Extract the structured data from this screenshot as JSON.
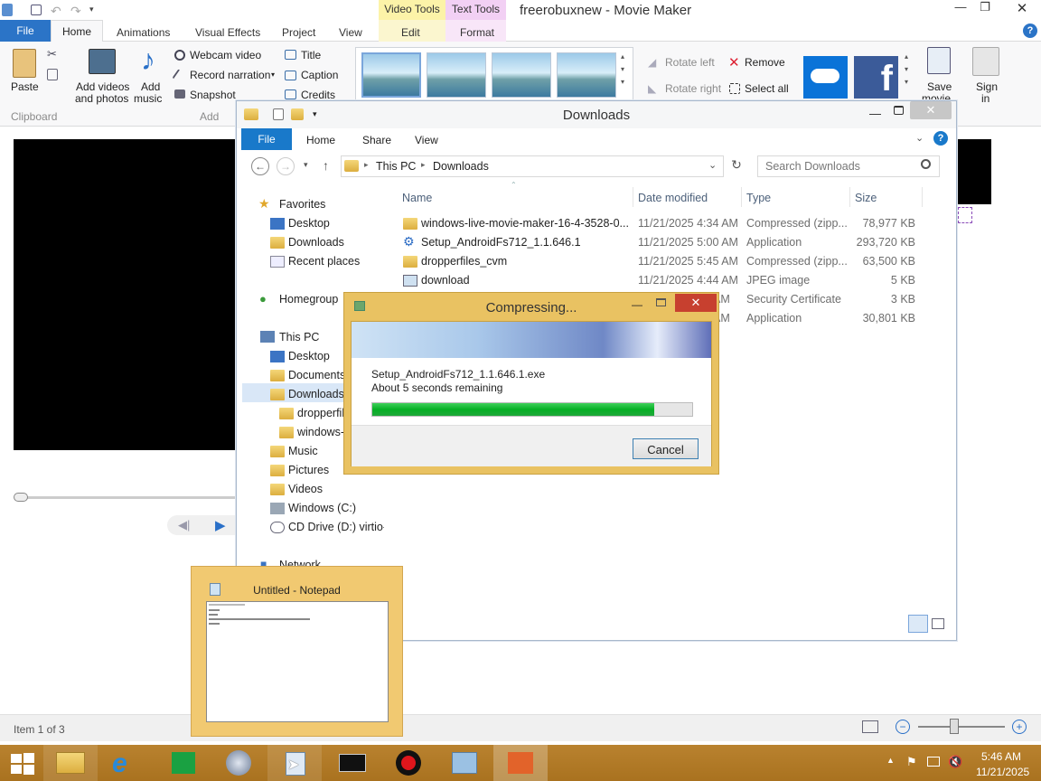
{
  "moviemaker": {
    "title": "freerobuxnew - Movie Maker",
    "context_tab_video": "Video Tools",
    "context_tab_text": "Text Tools",
    "tabs": {
      "file": "File",
      "home": "Home",
      "animations": "Animations",
      "visual_effects": "Visual Effects",
      "project": "Project",
      "view": "View",
      "edit": "Edit",
      "format": "Format"
    },
    "ribbon": {
      "paste": "Paste",
      "add_videos": "Add videos",
      "and_photos": "and photos",
      "add": "Add",
      "music": "music",
      "webcam": "Webcam video",
      "narration": "Record narration",
      "snapshot": "Snapshot",
      "title_btn": "Title",
      "caption": "Caption",
      "credits": "Credits",
      "rotate_left": "Rotate left",
      "rotate_right": "Rotate right",
      "remove": "Remove",
      "select_all": "Select all",
      "save": "Save",
      "movie": "movie",
      "sign": "Sign",
      "in": "in",
      "group_clipboard": "Clipboard",
      "group_add": "Add"
    },
    "status": "Item 1 of 3"
  },
  "explorer": {
    "title": "Downloads",
    "tabs": {
      "file": "File",
      "home": "Home",
      "share": "Share",
      "view": "View"
    },
    "address": [
      "This PC",
      "Downloads"
    ],
    "search_placeholder": "Search Downloads",
    "nav": {
      "favorites": "Favorites",
      "desktop": "Desktop",
      "downloads": "Downloads",
      "recent": "Recent places",
      "homegroup": "Homegroup",
      "thispc": "This PC",
      "pc_desktop": "Desktop",
      "documents": "Documents",
      "pc_downloads": "Downloads",
      "sub1": "dropperfil",
      "sub2": "windows-",
      "music": "Music",
      "pictures": "Pictures",
      "videos": "Videos",
      "cdrive": "Windows (C:)",
      "ddrive": "CD Drive (D:) virtio-v",
      "network": "Network"
    },
    "columns": {
      "name": "Name",
      "date": "Date modified",
      "type": "Type",
      "size": "Size"
    },
    "files": [
      {
        "name": "windows-live-movie-maker-16-4-3528-0...",
        "date": "11/21/2025 4:34 AM",
        "type": "Compressed (zipp...",
        "size": "78,977 KB"
      },
      {
        "name": "Setup_AndroidFs712_1.1.646.1",
        "date": "11/21/2025 5:00 AM",
        "type": "Application",
        "size": "293,720 KB"
      },
      {
        "name": "dropperfiles_cvm",
        "date": "11/21/2025 5:45 AM",
        "type": "Compressed (zipp...",
        "size": "63,500 KB"
      },
      {
        "name": "download",
        "date": "11/21/2025 4:44 AM",
        "type": "JPEG image",
        "size": "5 KB"
      },
      {
        "name": "",
        "date": "AM",
        "type": "Security Certificate",
        "size": "3 KB"
      },
      {
        "name": "",
        "date": "AM",
        "type": "Application",
        "size": "30,801 KB"
      }
    ]
  },
  "compress": {
    "title": "Compressing...",
    "file": "Setup_AndroidFs712_1.1.646.1.exe",
    "remaining": "About 5 seconds remaining",
    "progress_pct": 88,
    "cancel": "Cancel"
  },
  "notepad": {
    "title": "Untitled - Notepad"
  },
  "taskbar": {
    "time": "5:46 AM",
    "date": "11/21/2025"
  }
}
